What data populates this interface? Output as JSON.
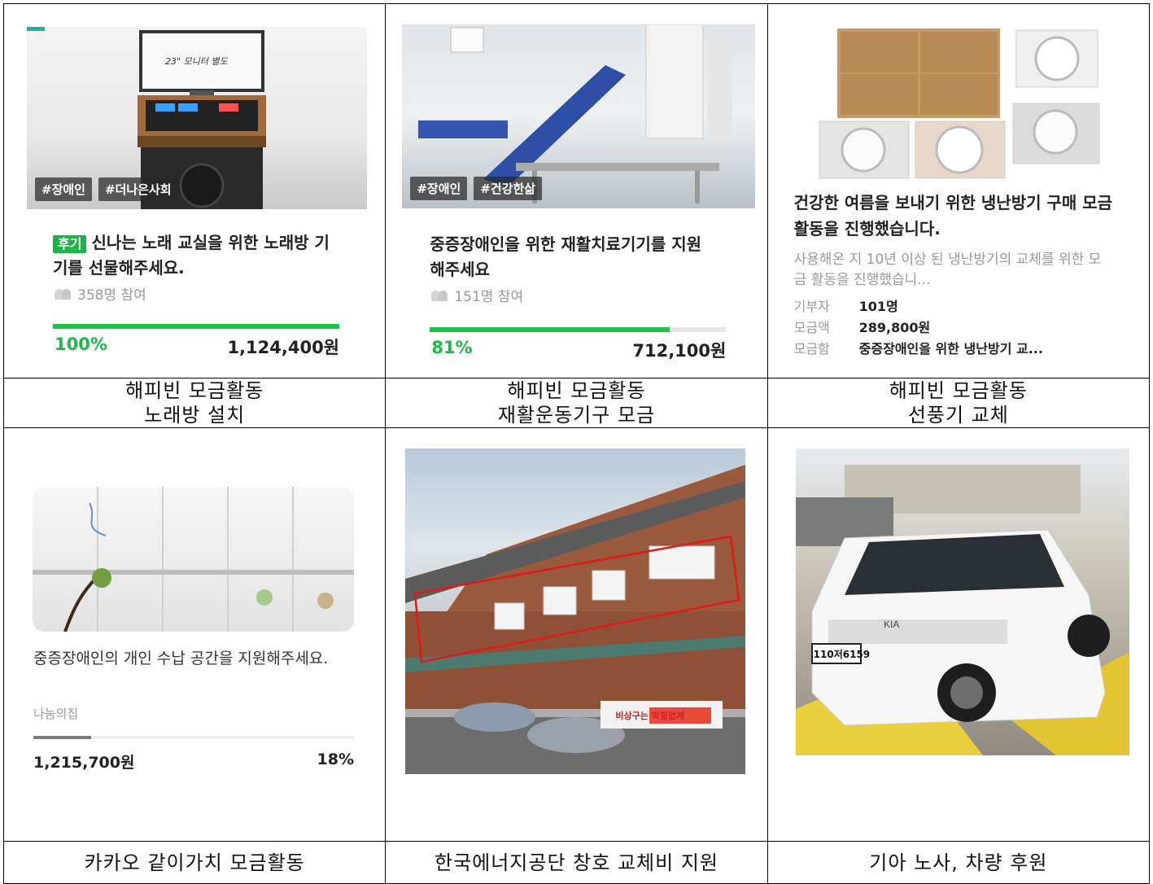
{
  "cards": [
    {
      "tags": [
        "#장애인",
        "#더나은사회"
      ],
      "badge": "후기",
      "title": "신나는 노래 교실을 위한 노래방 기기를 선물해주세요.",
      "participants": "358명 참여",
      "percent_label": "100%",
      "progress": 1.0,
      "amount": "1,124,400원",
      "monitor_label": "23\" 모니터 별도",
      "caption": [
        "해피빈 모금활동",
        "노래방 설치"
      ]
    },
    {
      "tags": [
        "#장애인",
        "#건강한삶"
      ],
      "title": "중증장애인을 위한 재활치료기기를 지원해주세요",
      "participants": "151명 참여",
      "percent_label": "81%",
      "progress": 0.81,
      "amount": "712,100원",
      "caption": [
        "해피빈 모금활동",
        "재활운동기구 모금"
      ]
    },
    {
      "title": "건강한 여름을 보내기 위한 냉난방기 구매 모금 활동을 진행했습니다.",
      "description": "사용해온 지 10년 이상 된 냉난방기의 교체를 위한 모금 활동을 진행했습니...",
      "donors_label": "기부자",
      "donors_value": "101명",
      "raised_label": "모금액",
      "raised_value": "289,800원",
      "box_label": "모금함",
      "box_value": "중증장애인을 위한 냉난방기 교...",
      "caption": [
        "해피빈 모금활동",
        "선풍기 교체"
      ]
    },
    {
      "title": "중증장애인의 개인 수납 공간을 지원해주세요.",
      "org": "나눔의집",
      "progress": 0.18,
      "amount": "1,215,700원",
      "percent_label": "18%",
      "caption": [
        "카카오 같이가치 모금활동"
      ]
    },
    {
      "banner": "비상구는 막힘없게",
      "caption": [
        "한국에너지공단 창호 교체비 지원"
      ]
    },
    {
      "plate": "110저6159",
      "caption": [
        "기아 노사, 차량 후원"
      ]
    }
  ],
  "colors": {
    "accent_green": "#1cc347",
    "border": "#000000"
  }
}
